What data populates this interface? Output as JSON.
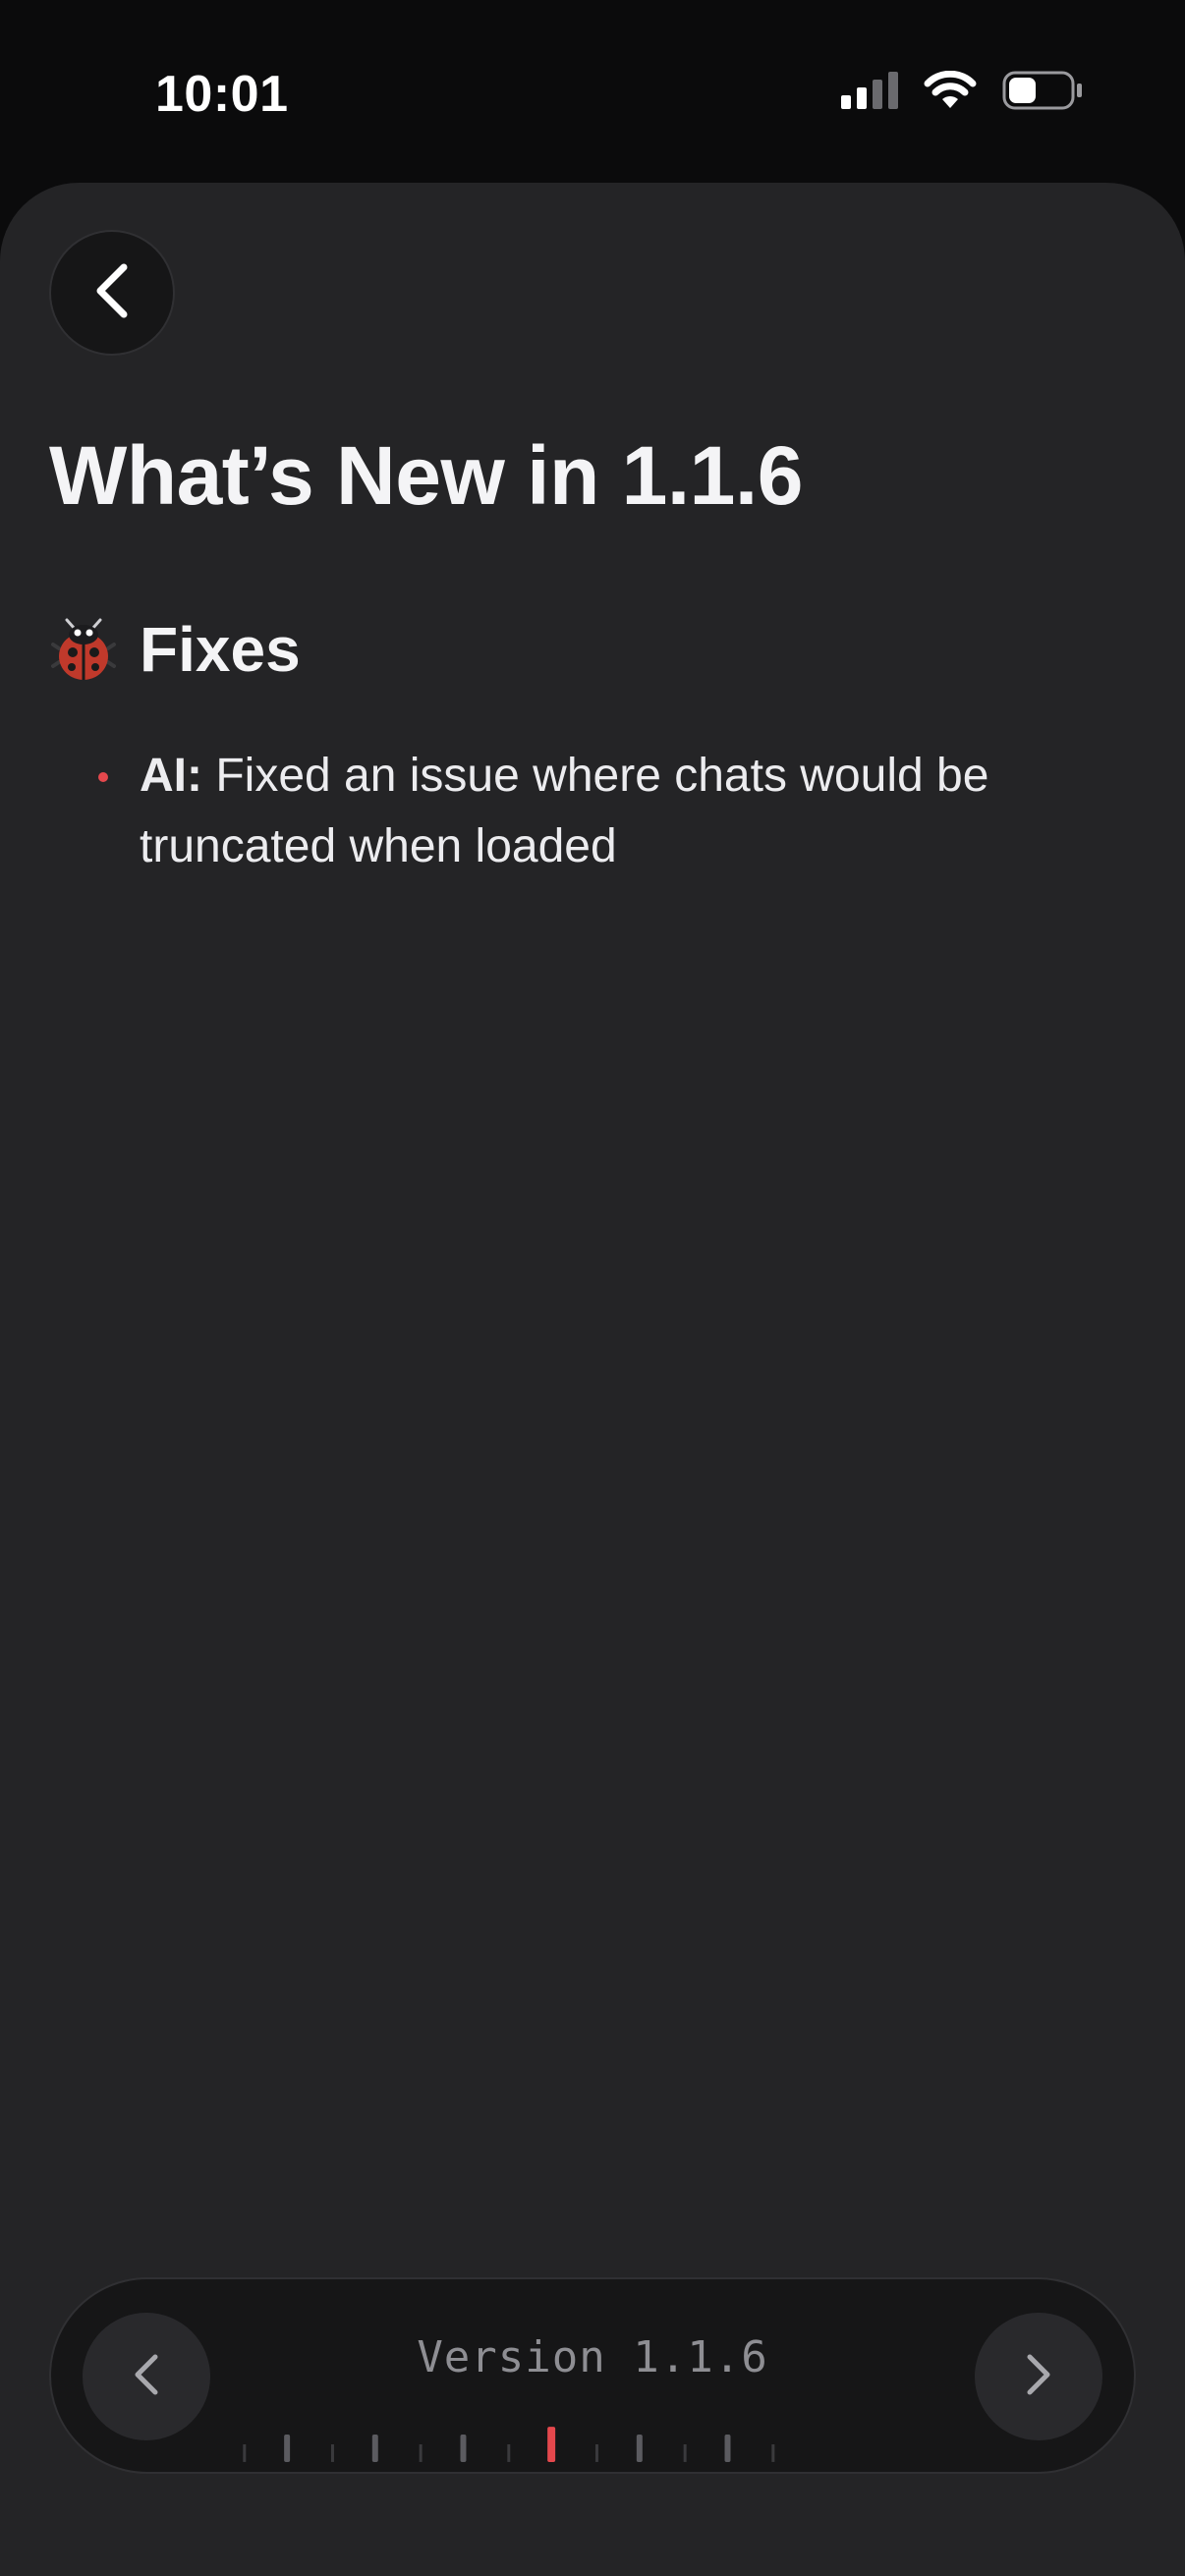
{
  "status_bar": {
    "time": "10:01",
    "signal_icon": "cellular-signal-icon",
    "wifi_icon": "wifi-icon",
    "battery_icon": "battery-icon",
    "battery_level": 0.45
  },
  "header": {
    "back_icon": "chevron-left-icon",
    "title": "What’s New in 1.1.6"
  },
  "sections": [
    {
      "icon": "ladybug-icon",
      "title": "Fixes",
      "items": [
        {
          "area": "AI:",
          "text": "Fixed an issue where chats would be truncated when loaded"
        }
      ]
    }
  ],
  "version_selector": {
    "label": "Version 1.1.6",
    "prev_icon": "chevron-left-icon",
    "next_icon": "chevron-right-icon",
    "active_tick_color": "#e5484d"
  },
  "colors": {
    "accent": "#e5484d",
    "sheet_background": "#242426",
    "status_background": "#0b0b0c"
  }
}
